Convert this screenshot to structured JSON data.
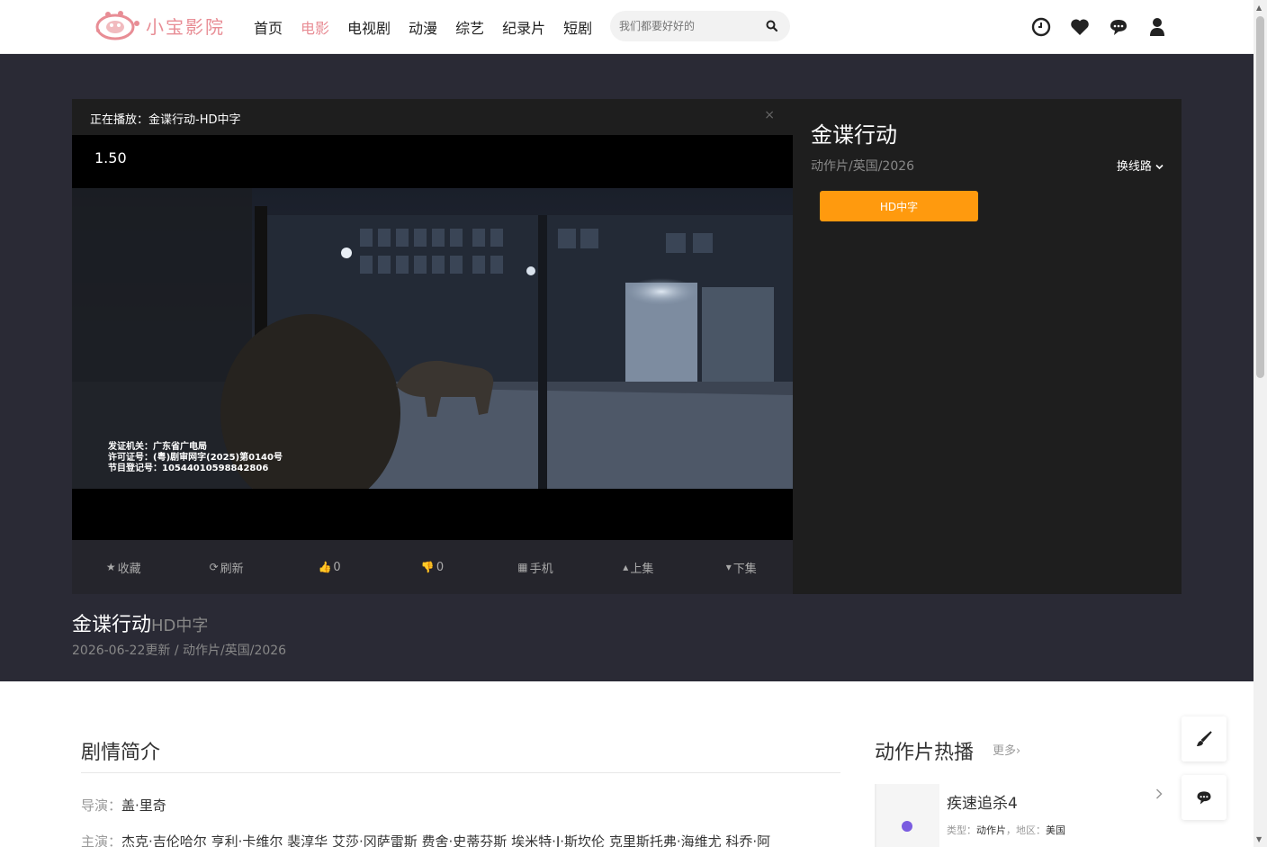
{
  "header": {
    "logo_text": "小宝影院",
    "nav": [
      "首页",
      "电影",
      "电视剧",
      "动漫",
      "综艺",
      "纪录片",
      "短剧"
    ],
    "active_nav": "电影",
    "search_placeholder": "我们都要好好的",
    "icons": [
      "history-icon",
      "heart-icon",
      "chat-icon",
      "user-icon"
    ]
  },
  "player": {
    "now_playing": "正在播放：金谍行动-HD中字",
    "close": "×",
    "speed": "1.50",
    "license_lines": [
      "发证机关：广东省广电局",
      "许可证号：(粤)剧审网字(2025)第0140号",
      "节目登记号：10544010598842806"
    ],
    "controls": [
      {
        "icon": "★",
        "label": "收藏"
      },
      {
        "icon": "⟳",
        "label": "刷新"
      },
      {
        "icon": "👍",
        "label": "0"
      },
      {
        "icon": "👎",
        "label": "0"
      },
      {
        "icon": "▦",
        "label": "手机"
      },
      {
        "icon": "▴",
        "label": "上集"
      },
      {
        "icon": "▾",
        "label": "下集"
      }
    ],
    "side_handle": "›"
  },
  "info_panel": {
    "title": "金谍行动",
    "meta": "动作片/英国/2026",
    "switch_line": "换线路",
    "episode": "HD中字"
  },
  "movie": {
    "title": "金谍行动",
    "quality": "HD中字",
    "updated": "2026-06-22更新",
    "sep": " / ",
    "category": "动作片",
    "region": "英国",
    "year": "2026"
  },
  "synopsis": {
    "title": "剧情简介",
    "director_label": "导演：",
    "director": "盖·里奇",
    "cast_label": "主演：",
    "cast": [
      "杰克·吉伦哈尔",
      "亨利·卡维尔",
      "裴淳华",
      "艾莎·冈萨雷斯",
      "费舍·史蒂芬斯",
      "埃米特·J·斯坎伦",
      "克里斯托弗·海维尤",
      "科乔·阿"
    ]
  },
  "hot": {
    "title": "动作片热播",
    "more": "更多›",
    "items": [
      {
        "name": "疾速追杀4",
        "type_label": "类型：",
        "type": "动作片",
        "region_label": "，地区：",
        "region": "美国",
        "accent": "#7a5ce0"
      }
    ]
  },
  "colors": {
    "brand": "#e88d95",
    "hero_bg": "#2a2a35",
    "episode_btn": "#ff9a0e"
  }
}
